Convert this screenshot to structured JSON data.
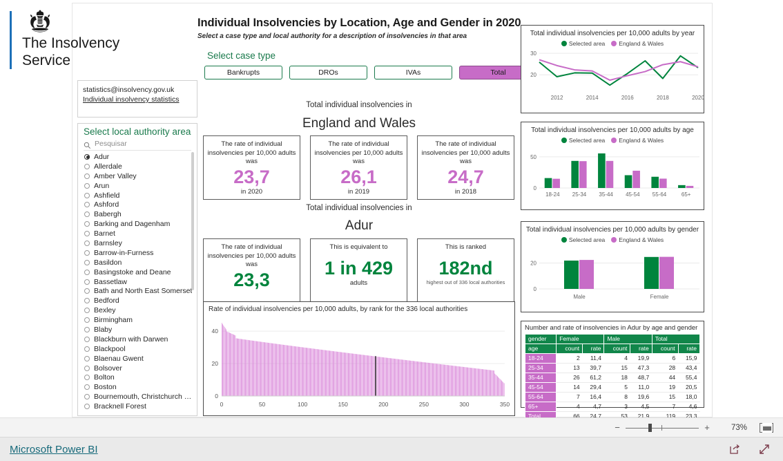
{
  "brand": {
    "line1": "The Insolvency",
    "line2": "Service",
    "crest_icon": "uk-royal-crest-icon"
  },
  "contact": {
    "email": "statistics@insolvency.gov.uk",
    "link": "Individual insolvency statistics"
  },
  "local_authority": {
    "title": "Select local authority area",
    "search_placeholder": "Pesquisar",
    "search_icon": "search-icon",
    "selected": "Adur",
    "items": [
      "Adur",
      "Allerdale",
      "Amber Valley",
      "Arun",
      "Ashfield",
      "Ashford",
      "Babergh",
      "Barking and Dagenham",
      "Barnet",
      "Barnsley",
      "Barrow-in-Furness",
      "Basildon",
      "Basingstoke and Deane",
      "Bassetlaw",
      "Bath and North East Somerset",
      "Bedford",
      "Bexley",
      "Birmingham",
      "Blaby",
      "Blackburn with Darwen",
      "Blackpool",
      "Blaenau Gwent",
      "Bolsover",
      "Bolton",
      "Boston",
      "Bournemouth, Christchurch a…",
      "Bracknell Forest"
    ]
  },
  "header": {
    "title": "Individual Insolvencies by Location, Age and Gender in 2020",
    "subtitle": "Select a case type and local authority for a description of insolvencies in that area",
    "case_type_label": "Select case type",
    "case_types": [
      {
        "label": "Bankrupts",
        "active": false
      },
      {
        "label": "DROs",
        "active": false
      },
      {
        "label": "IVAs",
        "active": false
      },
      {
        "label": "Total",
        "active": true
      }
    ]
  },
  "national": {
    "heading": "Total individual insolvencies in",
    "area": "England and Wales",
    "cards": [
      {
        "caption": "The rate of individual insolvencies per 10,000 adults was",
        "value": "23,7",
        "footer": "in 2020"
      },
      {
        "caption": "The rate of individual insolvencies per 10,000 adults was",
        "value": "26,1",
        "footer": "in 2019"
      },
      {
        "caption": "The rate of individual insolvencies per 10,000 adults was",
        "value": "24,7",
        "footer": "in 2018"
      }
    ]
  },
  "local": {
    "heading": "Total individual insolvencies in",
    "area": "Adur",
    "cards": [
      {
        "caption": "The rate of individual insolvencies per 10,000 adults was",
        "value": "23,3",
        "footer": ""
      },
      {
        "caption": "This is equivalent to",
        "value": "1 in 429",
        "footer": "adults"
      },
      {
        "caption": "This is ranked",
        "value": "182nd",
        "footer": "highest out of 336 local authorities"
      }
    ]
  },
  "colors": {
    "magenta": "#c76cc7",
    "green": "#00843d",
    "table_header_green": "#11864a",
    "brand_blue": "#1d70b8",
    "link_teal": "#16697a"
  },
  "legend": {
    "selected_area": "Selected area",
    "england_wales": "England & Wales"
  },
  "status_bar": {
    "zoom_percent": "73%",
    "minus": "−",
    "plus": "+",
    "fit_icon": "fit-to-page-icon"
  },
  "footer": {
    "link": "Microsoft Power BI",
    "share_icon": "share-icon",
    "fullscreen_icon": "fullscreen-icon"
  },
  "chart_data": [
    {
      "type": "line",
      "id": "by-year",
      "title": "Total individual insolvencies per 10,000 adults by year",
      "xlabel": "",
      "ylabel": "",
      "ylim": [
        13,
        31
      ],
      "yticks": [
        20,
        30
      ],
      "x": [
        2011,
        2012,
        2013,
        2014,
        2015,
        2016,
        2017,
        2018,
        2019,
        2020
      ],
      "xticks": [
        2012,
        2014,
        2016,
        2018,
        2020
      ],
      "grid": true,
      "legend_position": "top",
      "series": [
        {
          "name": "Selected area",
          "color": "#00843d",
          "values": [
            25.9,
            19.1,
            20.9,
            20.8,
            15.2,
            20.6,
            26.5,
            18.3,
            28.8,
            23.3
          ]
        },
        {
          "name": "England & Wales",
          "color": "#c76cc7",
          "values": [
            27.0,
            24.3,
            22.3,
            21.8,
            17.5,
            19.6,
            21.5,
            24.7,
            26.1,
            23.7
          ]
        }
      ]
    },
    {
      "type": "bar",
      "id": "by-age",
      "title": "Total individual insolvencies per 10,000 adults by age",
      "categories": [
        "18-24",
        "25-34",
        "35-44",
        "45-54",
        "55-64",
        "65+"
      ],
      "xlabel": "",
      "ylabel": "",
      "ylim": [
        0,
        62
      ],
      "yticks": [
        0,
        50
      ],
      "grid": true,
      "legend_position": "top",
      "series": [
        {
          "name": "Selected area",
          "color": "#00843d",
          "values": [
            15.9,
            43.4,
            55.4,
            20.5,
            18.0,
            4.6
          ]
        },
        {
          "name": "England & Wales",
          "color": "#c76cc7",
          "values": [
            14.8,
            43.0,
            43.4,
            27.7,
            15.0,
            3.4
          ]
        }
      ]
    },
    {
      "type": "bar",
      "id": "by-gender",
      "title": "Total individual insolvencies per 10,000 adults by gender",
      "categories": [
        "Male",
        "Female"
      ],
      "xlabel": "",
      "ylabel": "",
      "ylim": [
        0,
        31
      ],
      "yticks": [
        0,
        20
      ],
      "grid": true,
      "legend_position": "top",
      "series": [
        {
          "name": "Selected area",
          "color": "#00843d",
          "values": [
            21.9,
            24.7
          ]
        },
        {
          "name": "England & Wales",
          "color": "#c76cc7",
          "values": [
            22.4,
            24.8
          ]
        }
      ]
    },
    {
      "type": "bar",
      "id": "rank",
      "title": "Rate of individual insolvencies per 10,000 adults, by rank for the 336 local authorities",
      "xlabel": "",
      "ylabel": "",
      "xlim": [
        0,
        350
      ],
      "xticks": [
        0,
        50,
        100,
        150,
        200,
        250,
        300,
        350
      ],
      "ylim": [
        0,
        46
      ],
      "yticks": [
        0,
        20,
        40
      ],
      "grid": true,
      "highlight_rank": 182,
      "highlight_value": 23.3,
      "bar_color": "#d77fd7",
      "note": "336 local authorities sorted descending by rate, from about 45 down to about 8"
    }
  ],
  "table": {
    "title": "Number and rate of insolvencies in Adur by age and gender",
    "group_headers": [
      "gender",
      "Female",
      "Male",
      "Total"
    ],
    "sub_headers": [
      "age",
      "count",
      "rate",
      "count",
      "rate",
      "count",
      "rate"
    ],
    "rows": [
      {
        "age": "18-24",
        "female_count": "2",
        "female_rate": "11,4",
        "male_count": "4",
        "male_rate": "19,9",
        "total_count": "6",
        "total_rate": "15,9"
      },
      {
        "age": "25-34",
        "female_count": "13",
        "female_rate": "39,7",
        "male_count": "15",
        "male_rate": "47,3",
        "total_count": "28",
        "total_rate": "43,4"
      },
      {
        "age": "35-44",
        "female_count": "26",
        "female_rate": "61,2",
        "male_count": "18",
        "male_rate": "48,7",
        "total_count": "44",
        "total_rate": "55,4"
      },
      {
        "age": "45-54",
        "female_count": "14",
        "female_rate": "29,4",
        "male_count": "5",
        "male_rate": "11,0",
        "total_count": "19",
        "total_rate": "20,5"
      },
      {
        "age": "55-64",
        "female_count": "7",
        "female_rate": "16,4",
        "male_count": "8",
        "male_rate": "19,6",
        "total_count": "15",
        "total_rate": "18,0"
      },
      {
        "age": "65+",
        "female_count": "4",
        "female_rate": "4,7",
        "male_count": "3",
        "male_rate": "4,5",
        "total_count": "7",
        "total_rate": "4,6"
      },
      {
        "age": "Total",
        "female_count": "66",
        "female_rate": "24,7",
        "male_count": "53",
        "male_rate": "21,9",
        "total_count": "119",
        "total_rate": "23,3"
      }
    ]
  }
}
